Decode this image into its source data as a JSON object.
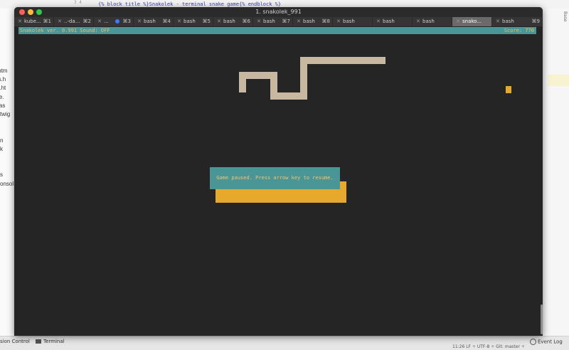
{
  "ide": {
    "code_line": "{% block title %}Snakolek - terminal snake game{% endblock %}",
    "line_numbers": "3\n4",
    "files": [
      "ad.htm",
      "ores.h",
      "age.ht",
      "table.",
      "k_bas",
      "twig",
      "",
      "",
      "n",
      "k",
      "",
      "",
      "s",
      "onsol"
    ],
    "right_vertical_label": "Base",
    "bottom_version_control": "sion Control",
    "bottom_terminal": "Terminal",
    "bottom_event_log": "Event Log",
    "bottom_status": "11:26  LF ÷  UTF-8 ÷  Git: master ÷"
  },
  "window": {
    "title": "1. snakolek_991"
  },
  "tabs": [
    {
      "label": "kube...",
      "shortcut": "⌘1",
      "dot": false,
      "active": false
    },
    {
      "label": "..-da...",
      "shortcut": "⌘2",
      "dot": false,
      "active": false
    },
    {
      "label": "...",
      "shortcut": "⌘3",
      "dot": true,
      "active": false
    },
    {
      "label": "bash",
      "shortcut": "⌘4",
      "dot": false,
      "active": false
    },
    {
      "label": "bash",
      "shortcut": "⌘5",
      "dot": false,
      "active": false
    },
    {
      "label": "bash",
      "shortcut": "⌘6",
      "dot": false,
      "active": false
    },
    {
      "label": "bash",
      "shortcut": "⌘7",
      "dot": false,
      "active": false
    },
    {
      "label": "bash",
      "shortcut": "⌘8",
      "dot": false,
      "active": false
    },
    {
      "label": "bash",
      "shortcut": "",
      "dot": false,
      "active": false
    },
    {
      "label": "bash",
      "shortcut": "",
      "dot": false,
      "active": false
    },
    {
      "label": "bash",
      "shortcut": "",
      "dot": false,
      "active": false
    },
    {
      "label": "snako...",
      "shortcut": "",
      "dot": false,
      "active": true
    },
    {
      "label": "bash",
      "shortcut": "⌘9",
      "dot": false,
      "active": false
    }
  ],
  "game": {
    "status_left": "Snakolek ver. 0.991 Sound: OFF",
    "score_text": "Score: 770",
    "pause_message": "Game paused. Press arrow key to resume."
  },
  "colors": {
    "snake": "#c8b8a2",
    "food": "#e6a92b",
    "panel": "#4a9596",
    "terminal_bg": "#252525"
  }
}
